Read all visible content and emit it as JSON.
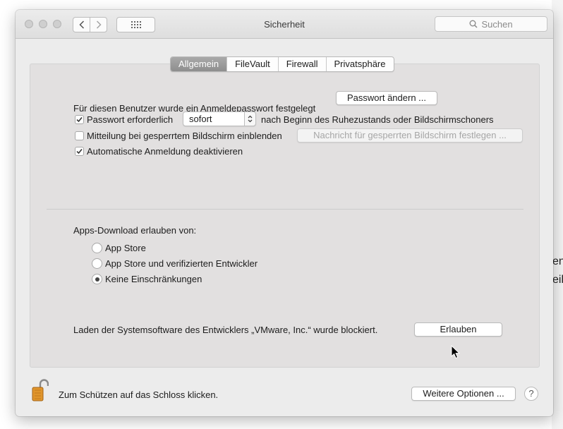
{
  "window": {
    "title": "Sicherheit"
  },
  "toolbar": {
    "search_placeholder": "Suchen"
  },
  "tabs": [
    {
      "label": "Allgemein",
      "active": true
    },
    {
      "label": "FileVault",
      "active": false
    },
    {
      "label": "Firewall",
      "active": false
    },
    {
      "label": "Privatsphäre",
      "active": false
    }
  ],
  "general": {
    "password_set_text": "Für diesen Benutzer wurde ein Anmeldepasswort festgelegt",
    "change_password_button": "Passwort ändern ...",
    "require_password": {
      "label": "Passwort erforderlich",
      "checked": true
    },
    "require_password_select": "sofort",
    "require_password_suffix": "nach Beginn des Ruhezustands oder Bildschirmschoners",
    "lock_message": {
      "label": "Mitteilung bei gesperrtem Bildschirm einblenden",
      "checked": false
    },
    "lock_message_button": "Nachricht für gesperrten Bildschirm festlegen ...",
    "disable_autologin": {
      "label": "Automatische Anmeldung deaktivieren",
      "checked": true
    }
  },
  "apps_download": {
    "label": "Apps-Download erlauben von:",
    "options": [
      {
        "label": "App Store",
        "selected": false
      },
      {
        "label": "App Store und verifizierten Entwickler",
        "selected": false
      },
      {
        "label": "Keine Einschränkungen",
        "selected": true
      }
    ]
  },
  "blocked": {
    "text": "Laden der Systemsoftware des Entwicklers „VMware, Inc.“ wurde blockiert.",
    "allow_button": "Erlauben"
  },
  "footer": {
    "lock_text": "Zum Schützen auf das Schloss klicken.",
    "advanced_button": "Weitere Optionen ...",
    "help_label": "?"
  },
  "desktop_fragments": [
    "en",
    "eib"
  ],
  "colors": {
    "active_tab": "#989898",
    "window_bg": "#ececec",
    "panel_bg": "#e2e0e0",
    "lock": "#e0952c"
  },
  "icons": [
    "back-arrow-icon",
    "forward-arrow-icon",
    "grid-icon",
    "search-icon",
    "checkmark-icon",
    "stepper-arrows-icon",
    "lock-open-icon",
    "cursor-icon"
  ]
}
